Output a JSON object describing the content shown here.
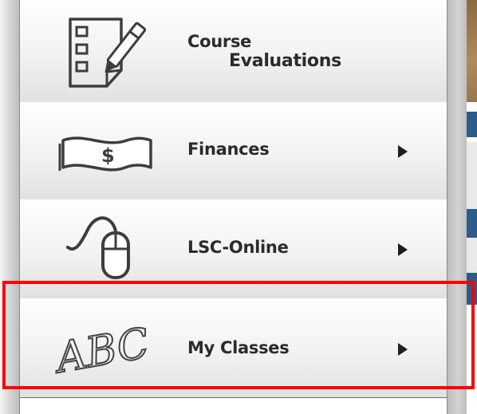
{
  "menu": {
    "items": [
      {
        "line1": "Course",
        "line2": "Evaluations",
        "icon": "checklist-pen-icon",
        "has_submenu": false
      },
      {
        "label": "Finances",
        "icon": "dollar-bill-icon",
        "has_submenu": true
      },
      {
        "label": "LSC-Online",
        "icon": "computer-mouse-icon",
        "has_submenu": true
      },
      {
        "label": "My Classes",
        "icon": "abc-handwriting-icon",
        "has_submenu": true
      }
    ]
  },
  "icon_text": {
    "dollar": "$",
    "abc": "ABC"
  },
  "colors": {
    "highlight": "#ff0000",
    "label": "#2b2b2b",
    "accent": "#2b5c8a"
  }
}
